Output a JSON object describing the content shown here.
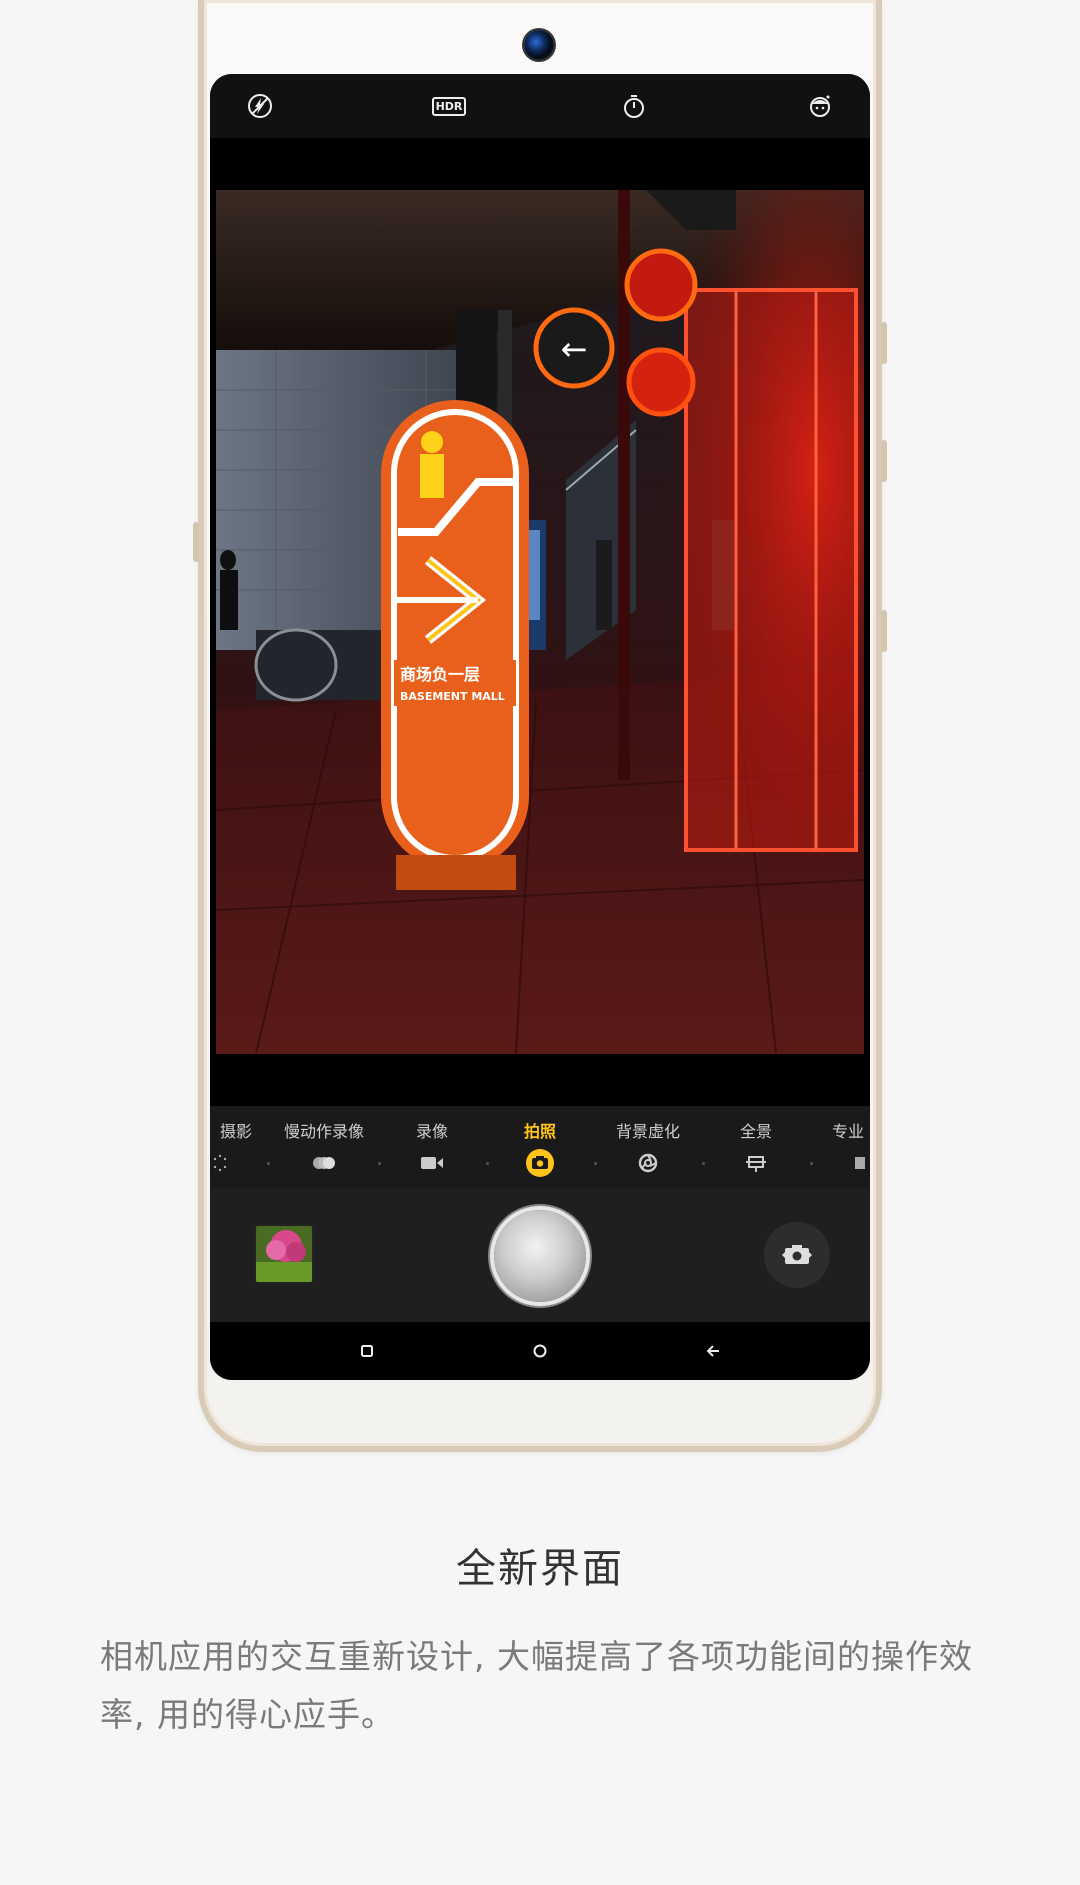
{
  "camera": {
    "top_bar": {
      "flash_icon": "flash-off-icon",
      "hdr_label": "HDR",
      "timer_icon": "timer-icon",
      "beauty_icon": "beauty-face-icon"
    },
    "modes": [
      {
        "label": "摄影",
        "icon": "timelapse-icon"
      },
      {
        "label": "慢动作录像",
        "icon": "slow-motion-icon"
      },
      {
        "label": "录像",
        "icon": "video-icon"
      },
      {
        "label": "拍照",
        "icon": "camera-icon",
        "active": true
      },
      {
        "label": "背景虚化",
        "icon": "aperture-icon"
      },
      {
        "label": "全景",
        "icon": "panorama-icon"
      },
      {
        "label": "专业",
        "icon": "pro-icon"
      }
    ],
    "controls": {
      "gallery_icon": "gallery-thumbnail",
      "shutter_icon": "shutter-button",
      "switch_icon": "switch-camera-icon"
    },
    "nav": {
      "recent_icon": "recent-apps-icon",
      "home_icon": "home-icon",
      "back_icon": "back-icon"
    },
    "viewfinder_signs": {
      "sign_cn": "商场负一层",
      "sign_en": "BASEMENT MALL"
    }
  },
  "colors": {
    "accent": "#ffc31a",
    "phone_frame": "#d9cbb8",
    "background": "#f6f6f6"
  },
  "headline": "全新界面",
  "description": "相机应用的交互重新设计, 大幅提高了各项功能间的操作效率, 用的得心应手。"
}
